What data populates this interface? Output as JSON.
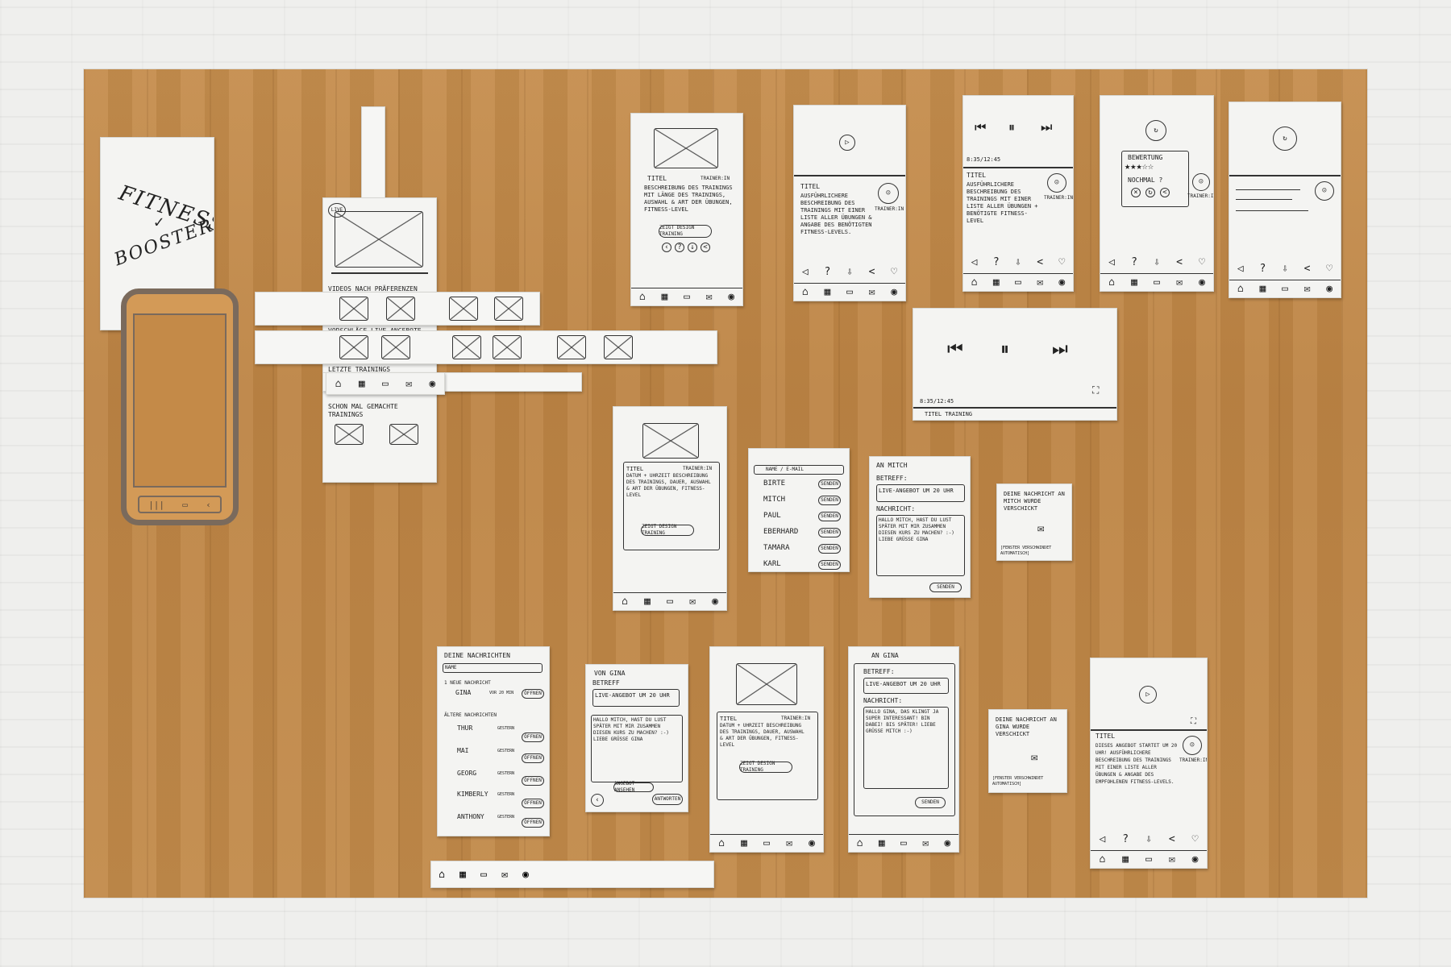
{
  "logo": {
    "line1": "FITNESS",
    "line2": "BOOSTER"
  },
  "home": {
    "sections": [
      "VIDEOS NACH PRÄFERENZEN",
      "VORSCHLÄGE LIVE-ANGEBOTE",
      "LETZTE TRAININGS",
      "SCHON MAL GEMACHTE TRAININGS"
    ],
    "live_badge": "LIVE"
  },
  "detail_screen": {
    "title": "TITEL",
    "trainer": "TRAINER:IN",
    "description": "BESCHREIBUNG DES TRAININGS MIT LÄNGE DES TRAININGS, AUSWAHL & ART DER ÜBUNGEN, FITNESS-LEVEL",
    "button": "ZEIGT DESIGN TRAINING"
  },
  "video_screen": {
    "title": "TITEL",
    "trainer": "TRAINER:IN",
    "description": "AUSFÜHRLICHERE BESCHREIBUNG DES TRAININGS MIT EINER LISTE ALLER ÜBUNGEN & ANGABE DES BENÖTIGTEN FITNESS-LEVELS."
  },
  "player_screen": {
    "time": "8:35/12:45",
    "title": "TITEL",
    "trainer": "TRAINER:IN",
    "description": "AUSFÜHRLICHERE BESCHREIBUNG DES TRAININGS MIT EINER LISTE ALLER ÜBUNGEN + BENÖTIGTE FITNESS-LEVEL"
  },
  "rating_screen": {
    "title": "BEWERTUNG",
    "again": "NOCHMAL ?",
    "trainer": "TRAINER:IN"
  },
  "landscape_player": {
    "time": "8:35/12:45",
    "title": "TITEL TRAINING"
  },
  "contacts": {
    "search": "NAME / E-MAIL",
    "send_label": "SENDEN",
    "names": [
      "BIRTE",
      "MITCH",
      "PAUL",
      "EBERHARD",
      "TAMARA",
      "KARL"
    ]
  },
  "compose_mitch": {
    "to": "AN MITCH",
    "subject_label": "BETREFF:",
    "subject": "LIVE-ANGEBOT UM 20 UHR",
    "message_label": "NACHRICHT:",
    "message": "HALLO MITCH, HAST DU LUST SPÄTER MIT MIR ZUSAMMEN DIESEN KURS ZU MACHEN? :-) LIEBE GRÜßE GINA",
    "send": "SENDEN"
  },
  "sent_confirm_mitch": {
    "text": "DEINE NACHRICHT AN MITCH WURDE VERSCHICKT",
    "note": "[FENSTER VERSCHWINDET AUTOMATISCH]"
  },
  "inbox": {
    "title": "DEINE NACHRICHTEN",
    "search": "NAME",
    "new_label": "1 NEUE NACHRICHT",
    "older_label": "ÄLTERE NACHRICHTEN",
    "open": "ÖFFNEN",
    "new_items": [
      {
        "name": "GINA",
        "time": "VOR 20 MIN"
      }
    ],
    "older_items": [
      {
        "name": "THUR",
        "time": "GESTERN"
      },
      {
        "name": "MAI",
        "time": "GESTERN"
      },
      {
        "name": "GEORG",
        "time": "GESTERN"
      },
      {
        "name": "KIMBERLY",
        "time": "GESTERN"
      },
      {
        "name": "ANTHONY",
        "time": "GESTERN"
      }
    ]
  },
  "message_from_gina": {
    "from": "VON GINA",
    "subject_label": "BETREFF",
    "subject": "LIVE-ANGEBOT UM 20 UHR",
    "message": "HALLO MITCH, HAST DU LUST SPÄTER MIT MIR ZUSAMMEN DIESEN KURS ZU MACHEN? :-) LIEBE GRÜßE GINA",
    "reply": "ANGEBOT ANSEHEN",
    "answer": "ANTWORTEN"
  },
  "detail_screen_2": {
    "title": "TITEL",
    "trainer": "TRAINER:IN",
    "description": "DATUM + UHRZEIT BESCHREIBUNG DES TRAININGS, DAUER, AUSWAHL & ART DER ÜBUNGEN, FITNESS-LEVEL",
    "button": "ZEIGT DESIGN TRAINING"
  },
  "compose_gina": {
    "to": "AN GINA",
    "subject_label": "BETREFF:",
    "subject": "LIVE-ANGEBOT UM 20 UHR",
    "message_label": "NACHRICHT:",
    "message": "HALLO GINA, DAS KLINGT JA SUPER INTERESSANT! BIN DABEI! BIS SPÄTER! LIEBE GRÜßE MITCH :-)",
    "send": "SENDEN"
  },
  "sent_confirm_gina": {
    "text": "DEINE NACHRICHT AN GINA WURDE VERSCHICKT",
    "note": "[FENSTER VERSCHWINDET AUTOMATISCH]"
  },
  "live_offer_screen": {
    "title": "TITEL",
    "description": "DIESES ANGEBOT STARTET UM 20 UHR! AUSFÜHRLICHERE BESCHREIBUNG DES TRAININGS MIT EINER LISTE ALLER ÜBUNGEN & ANGABE DES EMPFOHLENEN FITNESS-LEVELS.",
    "trainer": "TRAINER:IN"
  }
}
